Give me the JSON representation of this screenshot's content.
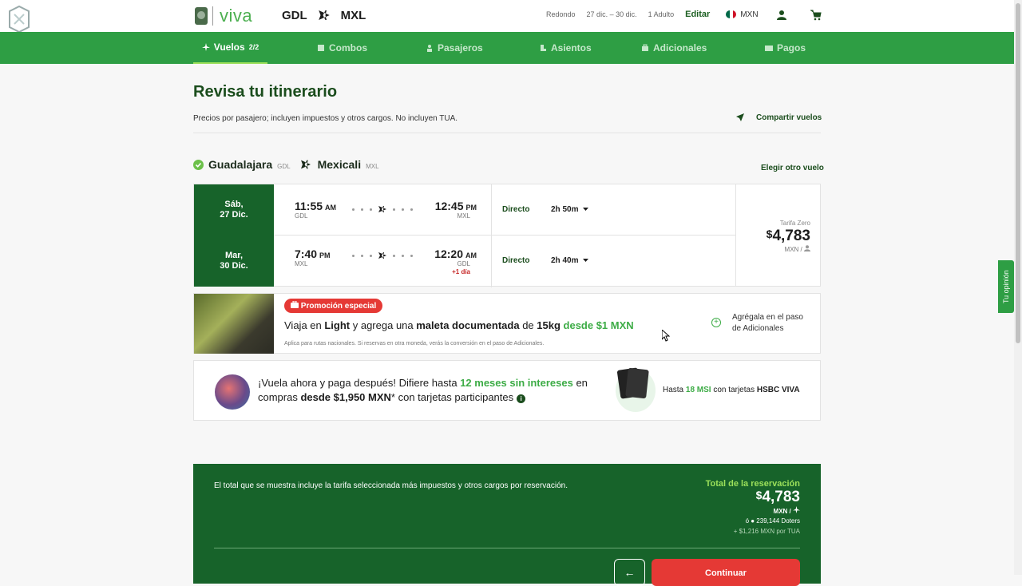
{
  "header": {
    "brand": "viva",
    "origin": "GDL",
    "destination": "MXL",
    "trip_type": "Redondo",
    "dates": "27 dic. – 30 dic.",
    "passengers": "1 Adulto",
    "edit": "Editar",
    "currency": "MXN"
  },
  "nav": {
    "items": [
      {
        "label": "Vuelos",
        "sub": "2/2"
      },
      {
        "label": "Combos"
      },
      {
        "label": "Pasajeros"
      },
      {
        "label": "Asientos"
      },
      {
        "label": "Adicionales"
      },
      {
        "label": "Pagos"
      }
    ]
  },
  "page": {
    "title": "Revisa tu itinerario",
    "note": "Precios por pasajero; incluyen impuestos y otros cargos. No incluyen TUA.",
    "share": "Compartir vuelos"
  },
  "leg": {
    "from_city": "Guadalajara",
    "from_code": "GDL",
    "to_city": "Mexicali",
    "to_code": "MXL",
    "other": "Elegir otro vuelo"
  },
  "flights": [
    {
      "day": "Sáb,",
      "date": "27 Dic.",
      "dep_time": "11:55",
      "dep_ampm": "AM",
      "dep_apt": "GDL",
      "arr_time": "12:45",
      "arr_ampm": "PM",
      "arr_apt": "MXL",
      "next_day": "",
      "type": "Directo",
      "duration": "2h 50m"
    },
    {
      "day": "Mar,",
      "date": "30 Dic.",
      "dep_time": "7:40",
      "dep_ampm": "PM",
      "dep_apt": "MXL",
      "arr_time": "12:20",
      "arr_ampm": "AM",
      "arr_apt": "GDL",
      "next_day": "+1 día",
      "type": "Directo",
      "duration": "2h 40m"
    }
  ],
  "fare": {
    "label": "Tarifa Zero",
    "symbol": "$",
    "price": "4,783",
    "unit": "MXN /"
  },
  "promo": {
    "badge": "Promoción especial",
    "t1": "Viaja en ",
    "t2": "Light",
    "t3": " y agrega una ",
    "t4": "maleta documentada",
    "t5": " de ",
    "t6": "15kg",
    "t7": " desde $1 MXN",
    "fine": "Aplica para rutas nacionales. Si reservas en otra moneda, verás la conversión en el paso de Adicionales.",
    "add_line1": "Agrégala en el paso",
    "add_line2": "de Adicionales"
  },
  "msi": {
    "t1": "¡Vuela ahora y paga después! Difiere hasta ",
    "t2": "12 meses sin intereses",
    "t3": " en compras ",
    "t4": "desde $1,950 MXN",
    "t5": "* con tarjetas participantes",
    "h1": "Hasta ",
    "h2": "18 MSI",
    "h3": " con tarjetas ",
    "h4": "HSBC VIVA"
  },
  "total": {
    "desc": "El total que se muestra incluye la tarifa seleccionada más impuestos y otros cargos por reservación.",
    "label": "Total de la reservación",
    "symbol": "$",
    "price": "4,783",
    "unit": "MXN /",
    "doters": "ó ● 239,144 Doters",
    "tua": "+ $1,216 MXN por TUA",
    "continue": "Continuar"
  },
  "feedback": "Tu opinión",
  "colors": {
    "brand_green": "#2e9e44",
    "dark_green": "#17632a",
    "accent": "#3dac46",
    "promo_red": "#e53935"
  }
}
